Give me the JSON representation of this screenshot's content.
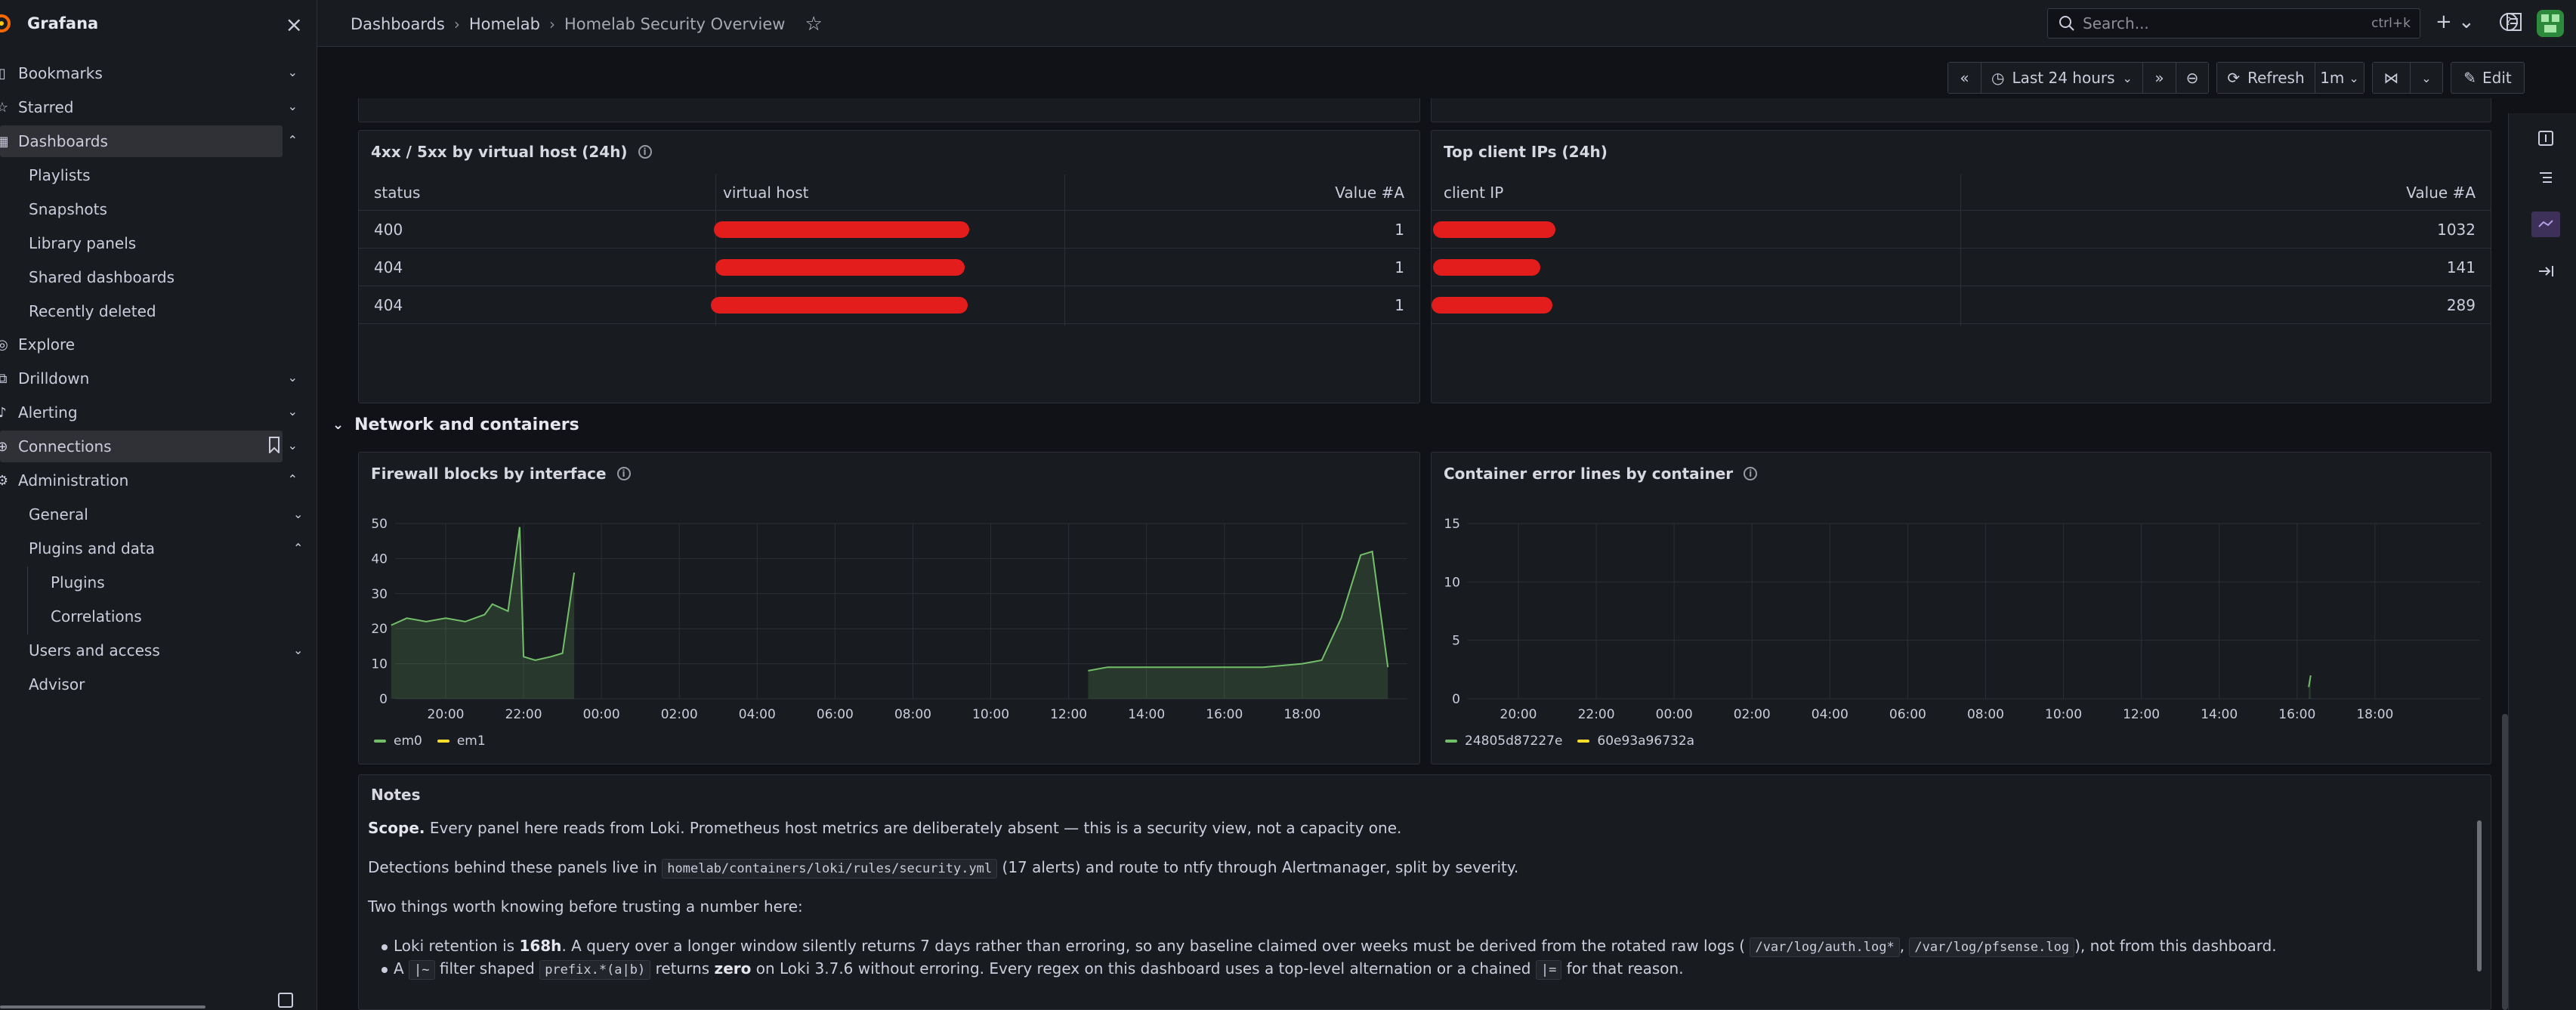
{
  "app": {
    "name": "Grafana"
  },
  "sidebar": {
    "items": [
      {
        "label": "Bookmarks"
      },
      {
        "label": "Starred"
      },
      {
        "label": "Dashboards"
      },
      {
        "label": "Playlists"
      },
      {
        "label": "Snapshots"
      },
      {
        "label": "Library panels"
      },
      {
        "label": "Shared dashboards"
      },
      {
        "label": "Recently deleted"
      },
      {
        "label": "Explore"
      },
      {
        "label": "Drilldown"
      },
      {
        "label": "Alerting"
      },
      {
        "label": "Connections"
      },
      {
        "label": "Administration"
      },
      {
        "label": "General"
      },
      {
        "label": "Plugins and data"
      },
      {
        "label": "Plugins"
      },
      {
        "label": "Correlations"
      },
      {
        "label": "Users and access"
      },
      {
        "label": "Advisor"
      }
    ]
  },
  "header": {
    "breadcrumb": [
      "Dashboards",
      "Homelab",
      "Homelab Security Overview"
    ],
    "search_placeholder": "Search...",
    "search_shortcut": "ctrl+k"
  },
  "toolbar": {
    "time_range": "Last 24 hours",
    "refresh_label": "Refresh",
    "refresh_interval": "1m",
    "edit_label": "Edit"
  },
  "panels": {
    "status_table": {
      "title": "4xx / 5xx by virtual host (24h)",
      "columns": [
        "status",
        "virtual host",
        "Value #A"
      ],
      "rows": [
        {
          "status": "400",
          "value": "1"
        },
        {
          "status": "404",
          "value": "1"
        },
        {
          "status": "404",
          "value": "1"
        }
      ]
    },
    "client_table": {
      "title": "Top client IPs (24h)",
      "columns": [
        "client IP",
        "Value #A"
      ],
      "rows": [
        {
          "value": "1032"
        },
        {
          "value": "141"
        },
        {
          "value": "289"
        }
      ]
    },
    "section_title": "Network and containers",
    "firewall": {
      "title": "Firewall blocks by interface",
      "y_ticks": [
        "0",
        "10",
        "20",
        "30",
        "40",
        "50"
      ],
      "x_ticks": [
        "20:00",
        "22:00",
        "00:00",
        "02:00",
        "04:00",
        "06:00",
        "08:00",
        "10:00",
        "12:00",
        "14:00",
        "16:00",
        "18:00"
      ],
      "legend": [
        "em0",
        "em1"
      ]
    },
    "containers": {
      "title": "Container error lines by container",
      "y_ticks": [
        "0",
        "5",
        "10",
        "15"
      ],
      "x_ticks": [
        "20:00",
        "22:00",
        "00:00",
        "02:00",
        "04:00",
        "06:00",
        "08:00",
        "10:00",
        "12:00",
        "14:00",
        "16:00",
        "18:00"
      ],
      "legend": [
        "24805d87227e",
        "60e93a96732a"
      ]
    }
  },
  "chart_data": [
    {
      "type": "area",
      "title": "Firewall blocks by interface",
      "ylim": [
        0,
        50
      ],
      "x_hours": [
        18.6,
        19.0,
        19.5,
        20.0,
        20.5,
        21.0,
        21.2,
        21.6,
        21.9,
        22.0,
        22.3,
        22.7,
        23.0,
        23.3,
        36.5,
        37.0,
        38.0,
        39.0,
        40.0,
        41.0,
        42.0,
        42.5,
        43.0,
        43.5,
        43.8,
        44.2
      ],
      "series": [
        {
          "name": "em0",
          "values": [
            21,
            23,
            22,
            23,
            22,
            24,
            27,
            25,
            49,
            12,
            11,
            12,
            13,
            36,
            8,
            9,
            9,
            9,
            9,
            9,
            10,
            11,
            23,
            41,
            42,
            9
          ]
        },
        {
          "name": "em1",
          "values": [
            0,
            0,
            0,
            0,
            0,
            0,
            0,
            0,
            0,
            0,
            0,
            0,
            0,
            0,
            0,
            0,
            0,
            0,
            0,
            0,
            0,
            0,
            0,
            0,
            0,
            0
          ]
        }
      ],
      "x_ticks": [
        "20:00",
        "22:00",
        "00:00",
        "02:00",
        "04:00",
        "06:00",
        "08:00",
        "10:00",
        "12:00",
        "14:00",
        "16:00",
        "18:00"
      ],
      "legend": "bottom"
    },
    {
      "type": "line",
      "title": "Container error lines by container",
      "ylim": [
        0,
        15
      ],
      "x_hours": [
        40.3,
        40.35
      ],
      "series": [
        {
          "name": "24805d87227e",
          "values": [
            1,
            2
          ]
        },
        {
          "name": "60e93a96732a",
          "values": []
        }
      ],
      "x_ticks": [
        "20:00",
        "22:00",
        "00:00",
        "02:00",
        "04:00",
        "06:00",
        "08:00",
        "10:00",
        "12:00",
        "14:00",
        "16:00",
        "18:00"
      ],
      "legend": "bottom"
    }
  ],
  "notes": {
    "title": "Notes",
    "scope_bold": "Scope.",
    "scope_text": " Every panel here reads from Loki. Prometheus host metrics are deliberately absent — this is a security view, not a capacity one.",
    "detections_pre": "Detections behind these panels live in ",
    "detections_code": "homelab/containers/loki/rules/security.yml",
    "detections_post": " (17 alerts) and route to ntfy through Alertmanager, split by severity.",
    "two_things": "Two things worth knowing before trusting a number here:",
    "b1_pre": "Loki retention is ",
    "b1_bold": "168h",
    "b1_mid": ". A query over a longer window silently returns 7 days rather than erroring, so any baseline claimed over weeks must be derived from the rotated raw logs (",
    "b1_code1": "/var/log/auth.log*",
    "b1_comma": ",",
    "b1_code2": "/var/log/pfsense.log",
    "b1_post": "), not from this dashboard.",
    "b2_pre": "A ",
    "b2_code1": "|~",
    "b2_mid1": " filter shaped ",
    "b2_code2": "prefix.*(a|b)",
    "b2_mid2": " returns ",
    "b2_bold": "zero",
    "b2_mid3": " on Loki 3.7.6 without erroring. Every regex on this dashboard uses a top-level alternation or a chained ",
    "b2_code3": "|=",
    "b2_post": " for that reason."
  },
  "colors": {
    "accent": "#73bf69",
    "em1": "#fade2a",
    "redaction": "#e31c1c",
    "bg": "#111217",
    "panel": "#181b1f"
  }
}
